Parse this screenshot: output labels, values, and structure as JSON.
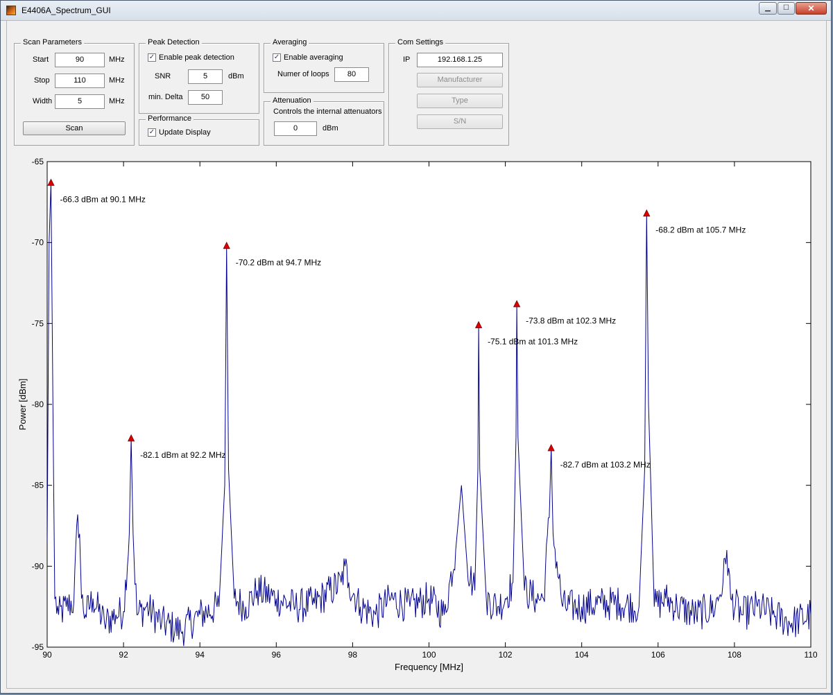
{
  "window": {
    "title": "E4406A_Spectrum_GUI",
    "buttons": {
      "minimize": "▁",
      "maximize": "☐",
      "close": "✕"
    }
  },
  "scan_parameters": {
    "title": "Scan Parameters",
    "start_label": "Start",
    "start_value": "90",
    "start_unit": "MHz",
    "stop_label": "Stop",
    "stop_value": "110",
    "stop_unit": "MHz",
    "width_label": "Width",
    "width_value": "5",
    "width_unit": "MHz",
    "scan_button": "Scan"
  },
  "peak_detection": {
    "title": "Peak Detection",
    "enable_checked": true,
    "enable_label": "Enable peak detection",
    "snr_label": "SNR",
    "snr_value": "5",
    "snr_unit": "dBm",
    "min_delta_label": "min. Delta",
    "min_delta_value": "50"
  },
  "performance": {
    "title": "Performance",
    "update_checked": true,
    "update_label": "Update Display"
  },
  "averaging": {
    "title": "Averaging",
    "enable_checked": true,
    "enable_label": "Enable averaging",
    "loops_label": "Numer of loops",
    "loops_value": "80"
  },
  "attenuation": {
    "title": "Attenuation",
    "description": "Controls the internal attenuators",
    "value": "0",
    "unit": "dBm"
  },
  "com_settings": {
    "title": "Com Settings",
    "ip_label": "IP",
    "ip_value": "192.168.1.25",
    "manufacturer_button": "Manufacturer",
    "type_button": "Type",
    "sn_button": "S/N"
  },
  "chart_data": {
    "type": "line",
    "xlabel": "Frequency [MHz]",
    "ylabel": "Power [dBm]",
    "xlim": [
      90,
      110
    ],
    "ylim": [
      -95,
      -65
    ],
    "x_ticks": [
      "90",
      "92",
      "94",
      "96",
      "98",
      "100",
      "102",
      "104",
      "106",
      "108",
      "110"
    ],
    "y_ticks": [
      "-65",
      "-70",
      "-75",
      "-80",
      "-85",
      "-90",
      "-95"
    ],
    "grid": false,
    "colors": {
      "line": "#00008b",
      "marker": "#dd0000"
    },
    "series": [
      {
        "x": [
          90.0,
          90.05,
          90.1,
          90.15,
          90.2,
          90.3,
          90.5,
          90.7,
          90.8,
          90.85,
          90.9,
          91.0,
          91.2,
          91.5,
          91.8,
          92.0,
          92.15,
          92.2,
          92.25,
          92.35,
          92.6,
          93.0,
          93.5,
          94.0,
          94.5,
          94.65,
          94.7,
          94.75,
          94.9,
          95.2,
          95.5,
          96.0,
          96.5,
          97.0,
          97.7,
          97.8,
          97.9,
          98.2,
          98.6,
          99.0,
          99.5,
          100.0,
          100.4,
          100.7,
          100.85,
          101.0,
          101.2,
          101.28,
          101.3,
          101.33,
          101.5,
          101.8,
          102.0,
          102.2,
          102.28,
          102.3,
          102.33,
          102.5,
          102.8,
          103.0,
          103.15,
          103.2,
          103.25,
          103.5,
          104.0,
          104.5,
          105.0,
          105.5,
          105.65,
          105.7,
          105.75,
          105.9,
          106.2,
          106.5,
          107.0,
          107.5,
          107.7,
          107.8,
          107.9,
          108.2,
          108.6,
          109.0,
          109.5,
          110.0
        ],
        "y": [
          -88.5,
          -70,
          -66.3,
          -80,
          -92,
          -93,
          -92.5,
          -92.2,
          -86.8,
          -88,
          -92,
          -93,
          -92,
          -93.5,
          -93,
          -92.8,
          -88,
          -82.1,
          -88,
          -93,
          -92.5,
          -93.5,
          -94,
          -93,
          -92.5,
          -85,
          -70.2,
          -84,
          -92,
          -92.5,
          -91.5,
          -92,
          -92.5,
          -92.3,
          -91,
          -90,
          -91,
          -92.5,
          -93,
          -92,
          -92.5,
          -92,
          -93,
          -89,
          -85,
          -90,
          -91.5,
          -84,
          -75.1,
          -84,
          -92,
          -92.5,
          -92,
          -91,
          -82,
          -73.8,
          -82,
          -91.5,
          -92,
          -92,
          -87,
          -82.7,
          -88,
          -92.5,
          -92.5,
          -92.3,
          -92.3,
          -92.5,
          -84,
          -68.2,
          -80,
          -92.5,
          -92,
          -92.5,
          -93,
          -92.5,
          -91,
          -89,
          -92,
          -93,
          -92.5,
          -93,
          -93.5,
          -93
        ]
      }
    ],
    "annotations": [
      {
        "x": 90.1,
        "y": -66.3,
        "text": "-66.3 dBm at 90.1 MHz"
      },
      {
        "x": 92.2,
        "y": -82.1,
        "text": "-82.1 dBm at 92.2 MHz"
      },
      {
        "x": 94.7,
        "y": -70.2,
        "text": "-70.2 dBm at 94.7 MHz"
      },
      {
        "x": 101.3,
        "y": -75.1,
        "text": "-75.1 dBm at 101.3 MHz"
      },
      {
        "x": 102.3,
        "y": -73.8,
        "text": "-73.8 dBm at 102.3 MHz"
      },
      {
        "x": 103.2,
        "y": -82.7,
        "text": "-82.7 dBm at 103.2 MHz"
      },
      {
        "x": 105.7,
        "y": -68.2,
        "text": "-68.2 dBm at 105.7 MHz"
      }
    ]
  }
}
